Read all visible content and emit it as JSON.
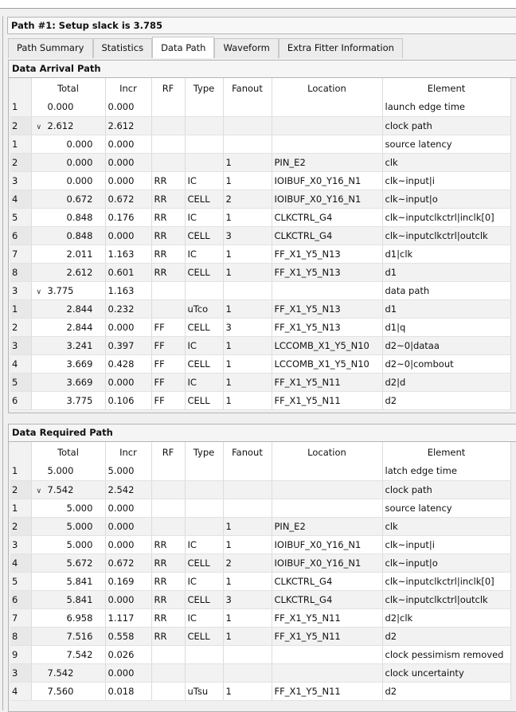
{
  "title": "Path #1: Setup slack is 3.785",
  "tabs": [
    "Path Summary",
    "Statistics",
    "Data Path",
    "Waveform",
    "Extra Fitter Information"
  ],
  "active_tab": "Data Path",
  "columns": [
    "",
    "Total",
    "Incr",
    "RF",
    "Type",
    "Fanout",
    "Location",
    "Element"
  ],
  "arrival": {
    "heading": "Data Arrival Path",
    "rows": [
      {
        "n": "1",
        "lvl": 0,
        "total": "0.000",
        "incr": "0.000",
        "rf": "",
        "type": "",
        "fanout": "",
        "loc": "",
        "el": "launch edge time"
      },
      {
        "n": "2",
        "lvl": 0,
        "exp": true,
        "total": "2.612",
        "incr": "2.612",
        "rf": "",
        "type": "",
        "fanout": "",
        "loc": "",
        "el": "clock path"
      },
      {
        "n": "1",
        "lvl": 1,
        "total": "0.000",
        "incr": "0.000",
        "rf": "",
        "type": "",
        "fanout": "",
        "loc": "",
        "el": "source latency"
      },
      {
        "n": "2",
        "lvl": 1,
        "total": "0.000",
        "incr": "0.000",
        "rf": "",
        "type": "",
        "fanout": "1",
        "loc": "PIN_E2",
        "el": "clk"
      },
      {
        "n": "3",
        "lvl": 1,
        "total": "0.000",
        "incr": "0.000",
        "rf": "RR",
        "type": "IC",
        "fanout": "1",
        "loc": "IOIBUF_X0_Y16_N1",
        "el": "clk~input|i"
      },
      {
        "n": "4",
        "lvl": 1,
        "total": "0.672",
        "incr": "0.672",
        "rf": "RR",
        "type": "CELL",
        "fanout": "2",
        "loc": "IOIBUF_X0_Y16_N1",
        "el": "clk~input|o"
      },
      {
        "n": "5",
        "lvl": 1,
        "total": "0.848",
        "incr": "0.176",
        "rf": "RR",
        "type": "IC",
        "fanout": "1",
        "loc": "CLKCTRL_G4",
        "el": "clk~inputclkctrl|inclk[0]"
      },
      {
        "n": "6",
        "lvl": 1,
        "total": "0.848",
        "incr": "0.000",
        "rf": "RR",
        "type": "CELL",
        "fanout": "3",
        "loc": "CLKCTRL_G4",
        "el": "clk~inputclkctrl|outclk"
      },
      {
        "n": "7",
        "lvl": 1,
        "total": "2.011",
        "incr": "1.163",
        "rf": "RR",
        "type": "IC",
        "fanout": "1",
        "loc": "FF_X1_Y5_N13",
        "el": "d1|clk"
      },
      {
        "n": "8",
        "lvl": 1,
        "total": "2.612",
        "incr": "0.601",
        "rf": "RR",
        "type": "CELL",
        "fanout": "1",
        "loc": "FF_X1_Y5_N13",
        "el": "d1"
      },
      {
        "n": "3",
        "lvl": 0,
        "exp": true,
        "total": "3.775",
        "incr": "1.163",
        "rf": "",
        "type": "",
        "fanout": "",
        "loc": "",
        "el": "data path"
      },
      {
        "n": "1",
        "lvl": 1,
        "total": "2.844",
        "incr": "0.232",
        "rf": "",
        "type": "uTco",
        "fanout": "1",
        "loc": "FF_X1_Y5_N13",
        "el": "d1"
      },
      {
        "n": "2",
        "lvl": 1,
        "total": "2.844",
        "incr": "0.000",
        "rf": "FF",
        "type": "CELL",
        "fanout": "3",
        "loc": "FF_X1_Y5_N13",
        "el": "d1|q"
      },
      {
        "n": "3",
        "lvl": 1,
        "total": "3.241",
        "incr": "0.397",
        "rf": "FF",
        "type": "IC",
        "fanout": "1",
        "loc": "LCCOMB_X1_Y5_N10",
        "el": "d2~0|dataa"
      },
      {
        "n": "4",
        "lvl": 1,
        "total": "3.669",
        "incr": "0.428",
        "rf": "FF",
        "type": "CELL",
        "fanout": "1",
        "loc": "LCCOMB_X1_Y5_N10",
        "el": "d2~0|combout"
      },
      {
        "n": "5",
        "lvl": 1,
        "total": "3.669",
        "incr": "0.000",
        "rf": "FF",
        "type": "IC",
        "fanout": "1",
        "loc": "FF_X1_Y5_N11",
        "el": "d2|d"
      },
      {
        "n": "6",
        "lvl": 1,
        "total": "3.775",
        "incr": "0.106",
        "rf": "FF",
        "type": "CELL",
        "fanout": "1",
        "loc": "FF_X1_Y5_N11",
        "el": "d2"
      }
    ]
  },
  "required": {
    "heading": "Data Required Path",
    "rows": [
      {
        "n": "1",
        "lvl": 0,
        "total": "5.000",
        "incr": "5.000",
        "rf": "",
        "type": "",
        "fanout": "",
        "loc": "",
        "el": "latch edge time"
      },
      {
        "n": "2",
        "lvl": 0,
        "exp": true,
        "total": "7.542",
        "incr": "2.542",
        "rf": "",
        "type": "",
        "fanout": "",
        "loc": "",
        "el": "clock path"
      },
      {
        "n": "1",
        "lvl": 1,
        "total": "5.000",
        "incr": "0.000",
        "rf": "",
        "type": "",
        "fanout": "",
        "loc": "",
        "el": "source latency"
      },
      {
        "n": "2",
        "lvl": 1,
        "total": "5.000",
        "incr": "0.000",
        "rf": "",
        "type": "",
        "fanout": "1",
        "loc": "PIN_E2",
        "el": "clk"
      },
      {
        "n": "3",
        "lvl": 1,
        "total": "5.000",
        "incr": "0.000",
        "rf": "RR",
        "type": "IC",
        "fanout": "1",
        "loc": "IOIBUF_X0_Y16_N1",
        "el": "clk~input|i"
      },
      {
        "n": "4",
        "lvl": 1,
        "total": "5.672",
        "incr": "0.672",
        "rf": "RR",
        "type": "CELL",
        "fanout": "2",
        "loc": "IOIBUF_X0_Y16_N1",
        "el": "clk~input|o"
      },
      {
        "n": "5",
        "lvl": 1,
        "total": "5.841",
        "incr": "0.169",
        "rf": "RR",
        "type": "IC",
        "fanout": "1",
        "loc": "CLKCTRL_G4",
        "el": "clk~inputclkctrl|inclk[0]"
      },
      {
        "n": "6",
        "lvl": 1,
        "total": "5.841",
        "incr": "0.000",
        "rf": "RR",
        "type": "CELL",
        "fanout": "3",
        "loc": "CLKCTRL_G4",
        "el": "clk~inputclkctrl|outclk"
      },
      {
        "n": "7",
        "lvl": 1,
        "total": "6.958",
        "incr": "1.117",
        "rf": "RR",
        "type": "IC",
        "fanout": "1",
        "loc": "FF_X1_Y5_N11",
        "el": "d2|clk"
      },
      {
        "n": "8",
        "lvl": 1,
        "total": "7.516",
        "incr": "0.558",
        "rf": "RR",
        "type": "CELL",
        "fanout": "1",
        "loc": "FF_X1_Y5_N11",
        "el": "d2"
      },
      {
        "n": "9",
        "lvl": 1,
        "total": "7.542",
        "incr": "0.026",
        "rf": "",
        "type": "",
        "fanout": "",
        "loc": "",
        "el": "clock pessimism removed"
      },
      {
        "n": "3",
        "lvl": 0,
        "total": "7.542",
        "incr": "0.000",
        "rf": "",
        "type": "",
        "fanout": "",
        "loc": "",
        "el": "clock uncertainty"
      },
      {
        "n": "4",
        "lvl": 0,
        "total": "7.560",
        "incr": "0.018",
        "rf": "",
        "type": "uTsu",
        "fanout": "1",
        "loc": "FF_X1_Y5_N11",
        "el": "d2"
      }
    ]
  }
}
